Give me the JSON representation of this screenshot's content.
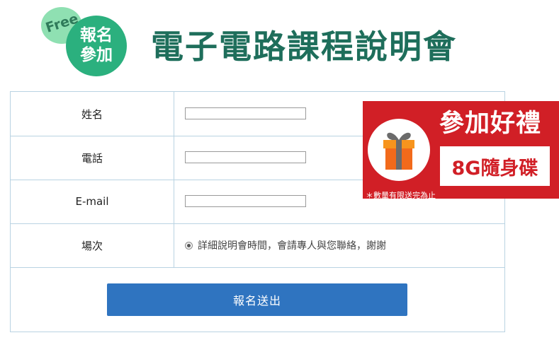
{
  "header": {
    "badge_free": "Free",
    "badge_line1": "報名",
    "badge_line2": "參加",
    "title": "電子電路課程說明會"
  },
  "form": {
    "rows": [
      {
        "label": "姓名",
        "type": "text",
        "value": ""
      },
      {
        "label": "電話",
        "type": "text",
        "value": ""
      },
      {
        "label": "E-mail",
        "type": "text",
        "value": ""
      },
      {
        "label": "場次",
        "type": "radio",
        "option": "詳細說明會時間，會請專人與您聯絡，謝謝",
        "checked": true
      }
    ],
    "submit_label": "報名送出"
  },
  "gift": {
    "heading": "參加好禮",
    "item": "8G隨身碟",
    "note": "＊數量有限送完為止",
    "icon": "gift-box-icon"
  },
  "colors": {
    "title": "#1e6e5b",
    "badge": "#2bb07e",
    "badge_free": "#8fe0b2",
    "submit": "#2f74c0",
    "gift_banner": "#d11f26",
    "border": "#b9d3e2"
  }
}
